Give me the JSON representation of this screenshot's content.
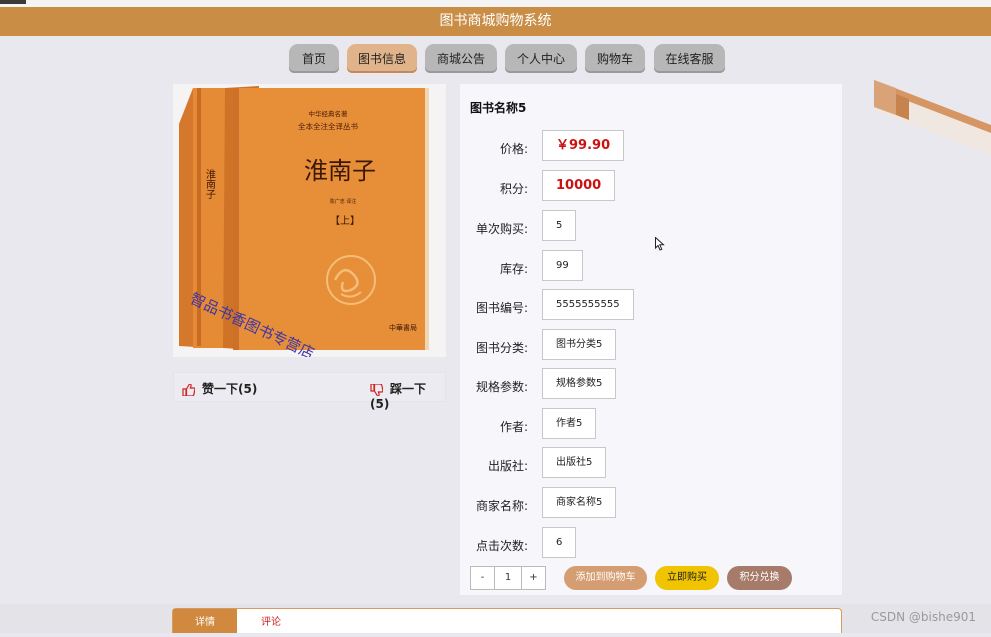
{
  "header": {
    "title": "图书商城购物系统"
  },
  "nav": [
    {
      "label": "首页"
    },
    {
      "label": "图书信息"
    },
    {
      "label": "商城公告"
    },
    {
      "label": "个人中心"
    },
    {
      "label": "购物车"
    },
    {
      "label": "在线客服"
    }
  ],
  "nav_active": "图书信息",
  "book_image": {
    "cover_title": "淮南子",
    "cover_series": "中华经典名著",
    "cover_subtitle": "全本全注全译丛书",
    "cover_volume": "【上】",
    "cover_author": "陈广忠 译注",
    "spine_title": "淮南子",
    "publisher_seal": "中華書局",
    "stamp_text": "智品书香图书专营店"
  },
  "votes": {
    "like_label": "赞一下(5)",
    "dislike_label": "踩一下(5)"
  },
  "product": {
    "name": "图书名称5",
    "fields": [
      {
        "label": "价格:",
        "value": "￥99.90"
      },
      {
        "label": "积分:",
        "value": "10000"
      },
      {
        "label": "单次购买:",
        "value": "5"
      },
      {
        "label": "库存:",
        "value": "99"
      },
      {
        "label": "图书编号:",
        "value": "5555555555"
      },
      {
        "label": "图书分类:",
        "value": "图书分类5"
      },
      {
        "label": "规格参数:",
        "value": "规格参数5"
      },
      {
        "label": "作者:",
        "value": "作者5"
      },
      {
        "label": "出版社:",
        "value": "出版社5"
      },
      {
        "label": "商家名称:",
        "value": "商家名称5"
      },
      {
        "label": "点击次数:",
        "value": "6"
      }
    ]
  },
  "quantity": {
    "minus": "-",
    "value": "1",
    "plus": "+"
  },
  "actions": {
    "add_cart": "添加到购物车",
    "buy_now": "立即购买",
    "points_exchange": "积分兑换"
  },
  "tabs": [
    {
      "label": "详情"
    },
    {
      "label": "评论"
    }
  ],
  "watermark": "CSDN @bishe901",
  "colors": {
    "header": "#c98d45",
    "nav_active": "#e0b38a",
    "price_red": "#cc1111",
    "add_cart": "#d59d72",
    "buy_now": "#f0c400",
    "points_exchange": "#a67b6a",
    "tab_active": "#d0893e"
  }
}
